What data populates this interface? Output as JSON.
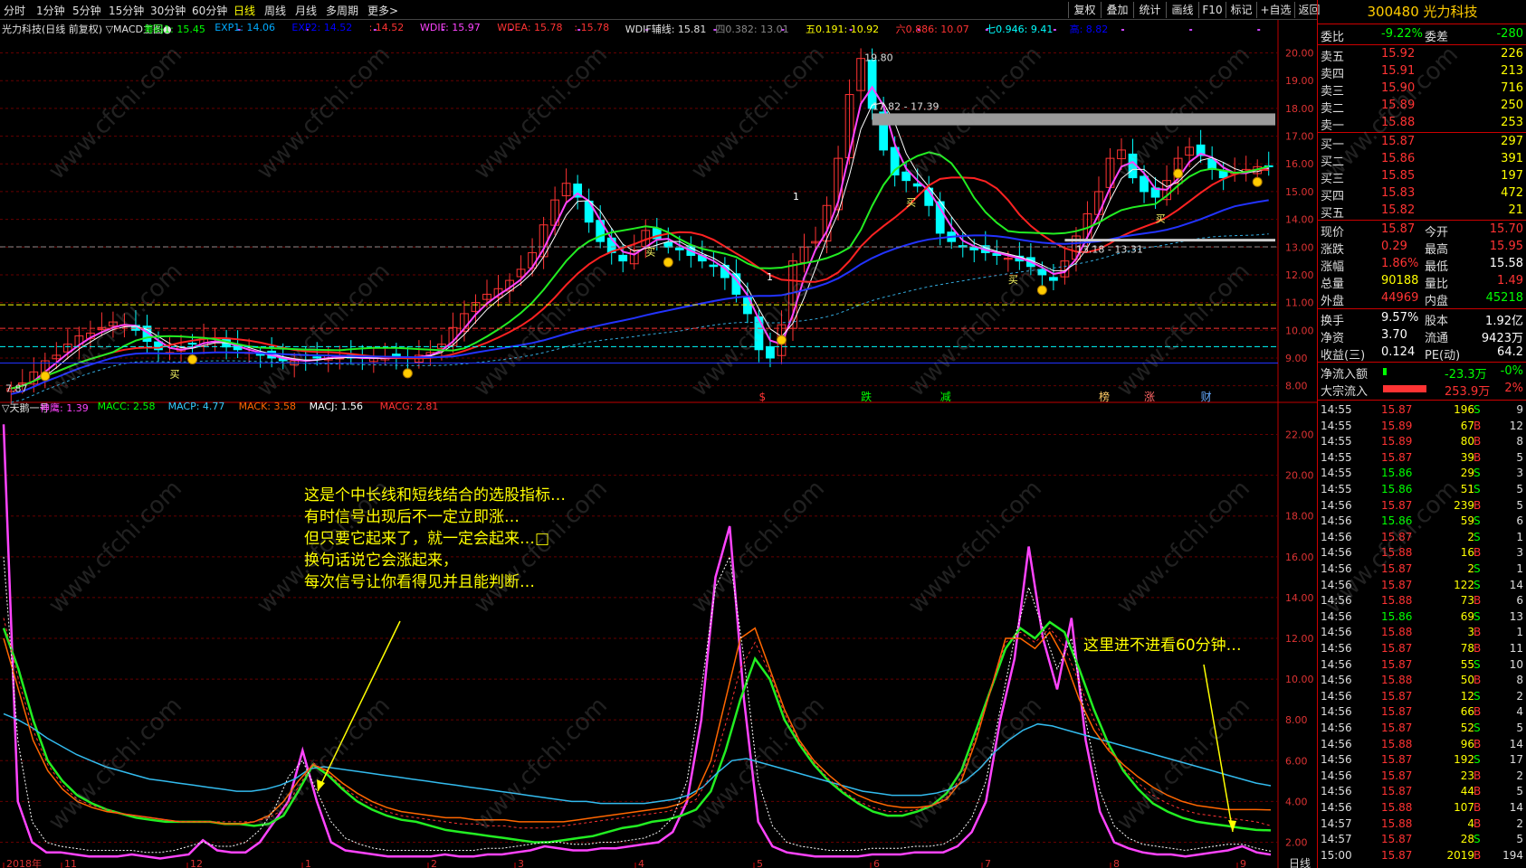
{
  "toolbar": {
    "periods": [
      "分时",
      "1分钟",
      "5分钟",
      "15分钟",
      "30分钟",
      "60分钟",
      "日线",
      "周线",
      "月线",
      "多周期",
      "更多>"
    ],
    "active": "日线",
    "right": [
      "复权",
      "叠加",
      "统计",
      "画线",
      "F10",
      "标记",
      "+自选",
      "返回"
    ]
  },
  "stock": {
    "code": "300480",
    "name": "光力科技"
  },
  "main_legend": [
    {
      "t": "光力科技(日线 前复权) ▽MACD主图●",
      "c": "#e0e0e0"
    },
    {
      "t": "筹码1: 15.45",
      "c": "#00ff00"
    },
    {
      "t": "EXP1: 14.06",
      "c": "#00aaff"
    },
    {
      "t": "EXP2: 14.52",
      "c": "#0000ff"
    },
    {
      "t": ": 14.52",
      "c": "#ff3333"
    },
    {
      "t": "WDIF: 15.97",
      "c": "#ff44ff"
    },
    {
      "t": "WDEA: 15.78",
      "c": "#ff3333"
    },
    {
      "t": ": 15.78",
      "c": "#ff3333"
    },
    {
      "t": "WDIF辅线: 15.81",
      "c": "#e0e0e0"
    },
    {
      "t": "四0.382: 13.01",
      "c": "#888888"
    },
    {
      "t": "五0.191: 10.92",
      "c": "#ffff00"
    },
    {
      "t": "六0.886: 10.07",
      "c": "#ff3333"
    },
    {
      "t": "七0.946: 9.41",
      "c": "#00ffff"
    },
    {
      "t": "高: 8.82",
      "c": "#0000ff"
    }
  ],
  "sub_legend": [
    {
      "t": "▽天鹅一号",
      "c": "#e0e0e0"
    },
    {
      "t": "神鹰: 1.39",
      "c": "#ff44ff"
    },
    {
      "t": "MACC: 2.58",
      "c": "#00ff00"
    },
    {
      "t": "MACP: 4.77",
      "c": "#33ccff"
    },
    {
      "t": "MACK: 3.58",
      "c": "#ff6600"
    },
    {
      "t": "MACJ: 1.56",
      "c": "#ffffff"
    },
    {
      "t": "MACG: 2.81",
      "c": "#ff3333"
    }
  ],
  "colors": {
    "up": "#ff3333",
    "down": "#00ffff",
    "bg": "#000000",
    "grid": "#c00000"
  },
  "chart_data": [
    {
      "type": "candlestick",
      "title": "光力科技(日线 前复权)",
      "ylim": [
        7.5,
        20.8
      ],
      "yticks": [
        8,
        9,
        10,
        11,
        12,
        13,
        14,
        15,
        16,
        17,
        18,
        19,
        20
      ],
      "ohlc_start": "2018-10",
      "close": [
        7.9,
        8.1,
        8.5,
        8.9,
        9.1,
        9.5,
        9.8,
        9.9,
        10.1,
        10.3,
        10.2,
        10.0,
        9.6,
        9.3,
        9.2,
        9.4,
        9.5,
        9.7,
        9.6,
        9.4,
        9.3,
        9.2,
        9.1,
        9.0,
        8.9,
        8.9,
        8.9,
        9.0,
        9.1,
        9.0,
        9.0,
        9.0,
        9.0,
        9.0,
        9.0,
        9.0,
        9.1,
        9.2,
        9.5,
        10.1,
        10.6,
        11.0,
        11.3,
        11.5,
        11.8,
        12.2,
        12.8,
        13.8,
        14.7,
        15.3,
        14.8,
        13.9,
        13.2,
        12.8,
        12.5,
        12.9,
        13.6,
        13.3,
        13.0,
        12.9,
        12.7,
        12.5,
        12.3,
        11.9,
        11.3,
        10.6,
        9.3,
        9.0,
        10.2,
        12.5,
        13.0,
        13.2,
        14.5,
        16.2,
        18.5,
        19.8,
        18.0,
        16.5,
        15.6,
        15.4,
        15.2,
        14.5,
        13.5,
        13.2,
        13.0,
        12.9,
        12.8,
        12.7,
        12.6,
        12.5,
        12.3,
        12.0,
        11.8,
        12.5,
        13.4,
        14.2,
        15.0,
        16.2,
        16.5,
        15.5,
        15.0,
        14.8,
        15.4,
        16.2,
        16.6,
        16.3,
        15.8,
        15.5,
        15.7,
        15.8,
        15.9,
        15.9
      ]
    },
    {
      "type": "line",
      "title": "天鹅一号",
      "ylim": [
        1.0,
        23.0
      ],
      "yticks": [
        2,
        4,
        6,
        8,
        10,
        12,
        14,
        16,
        18,
        20,
        22
      ],
      "xticks": [
        "2018年",
        "11",
        "12",
        "1",
        "2",
        "3",
        "4",
        "5",
        "6",
        "7",
        "8",
        "9"
      ],
      "series": [
        {
          "name": "神鹰",
          "values": [
            22.5,
            4.0,
            2.0,
            1.5,
            1.5,
            1.4,
            1.3,
            1.3,
            1.3,
            1.4,
            1.3,
            1.2,
            1.3,
            1.4,
            2.1,
            1.6,
            1.5,
            1.5,
            2.0,
            3.0,
            4.0,
            6.5,
            4.0,
            2.0,
            1.6,
            1.5,
            1.4,
            1.3,
            1.3,
            1.3,
            1.3,
            1.4,
            1.3,
            1.3,
            1.4,
            1.4,
            1.5,
            1.6,
            1.8,
            1.7,
            1.6,
            1.6,
            1.7,
            1.7,
            1.8,
            1.9,
            2.0,
            2.5,
            4.0,
            8.0,
            15.0,
            17.5,
            9.0,
            3.0,
            1.8,
            1.5,
            1.4,
            1.3,
            1.3,
            1.3,
            1.3,
            1.4,
            1.4,
            1.4,
            1.5,
            1.5,
            1.5,
            1.8,
            2.5,
            4.0,
            8.0,
            11.0,
            16.5,
            12.0,
            9.5,
            13.0,
            7.0,
            3.5,
            2.0,
            1.7,
            1.5,
            1.4,
            1.4,
            1.3,
            1.4,
            1.5,
            1.6,
            1.8,
            1.5,
            1.39
          ]
        },
        {
          "name": "MACC",
          "values": [
            12.5,
            10.5,
            8.0,
            6.0,
            5.0,
            4.3,
            3.9,
            3.6,
            3.4,
            3.2,
            3.1,
            3.0,
            3.0,
            3.0,
            3.0,
            2.9,
            2.9,
            2.8,
            2.9,
            3.3,
            4.5,
            5.8,
            5.3,
            4.6,
            4.0,
            3.6,
            3.3,
            3.1,
            3.0,
            2.8,
            2.6,
            2.5,
            2.4,
            2.3,
            2.2,
            2.1,
            2.0,
            2.0,
            2.1,
            2.2,
            2.3,
            2.5,
            2.7,
            2.8,
            3.0,
            3.1,
            3.3,
            3.6,
            4.5,
            6.5,
            9.0,
            11.0,
            10.0,
            8.0,
            6.8,
            5.8,
            5.0,
            4.4,
            3.9,
            3.5,
            3.3,
            3.3,
            3.5,
            3.8,
            4.4,
            5.5,
            7.5,
            9.5,
            11.5,
            12.5,
            12.0,
            12.8,
            12.3,
            10.5,
            8.5,
            6.8,
            5.5,
            4.6,
            3.9,
            3.5,
            3.2,
            3.0,
            2.9,
            2.8,
            2.7,
            2.6,
            2.58
          ]
        },
        {
          "name": "MACP",
          "values": [
            8.3,
            8.0,
            7.6,
            7.1,
            6.7,
            6.3,
            6.0,
            5.7,
            5.5,
            5.3,
            5.1,
            5.0,
            4.9,
            4.8,
            4.7,
            4.6,
            4.5,
            4.5,
            4.6,
            4.8,
            5.1,
            5.6,
            5.7,
            5.6,
            5.5,
            5.4,
            5.3,
            5.2,
            5.1,
            5.0,
            4.9,
            4.8,
            4.7,
            4.6,
            4.5,
            4.4,
            4.3,
            4.2,
            4.1,
            4.0,
            4.0,
            3.9,
            3.9,
            3.9,
            3.9,
            4.0,
            4.1,
            4.3,
            4.7,
            5.4,
            6.0,
            6.1,
            5.9,
            5.7,
            5.5,
            5.3,
            5.1,
            4.9,
            4.7,
            4.5,
            4.4,
            4.3,
            4.3,
            4.3,
            4.4,
            4.6,
            5.0,
            5.6,
            6.4,
            7.0,
            7.5,
            7.8,
            7.7,
            7.5,
            7.3,
            7.1,
            6.9,
            6.7,
            6.5,
            6.3,
            6.1,
            5.9,
            5.7,
            5.5,
            5.3,
            5.1,
            4.9,
            4.77
          ]
        },
        {
          "name": "MACK",
          "values": [
            12.0,
            9.5,
            7.0,
            5.5,
            4.6,
            4.0,
            3.7,
            3.5,
            3.4,
            3.3,
            3.2,
            3.1,
            3.0,
            3.0,
            3.0,
            2.9,
            2.9,
            3.0,
            3.3,
            4.0,
            5.0,
            5.8,
            5.5,
            4.9,
            4.4,
            4.0,
            3.7,
            3.5,
            3.4,
            3.3,
            3.2,
            3.2,
            3.1,
            3.1,
            3.1,
            3.0,
            3.0,
            3.0,
            3.0,
            3.1,
            3.2,
            3.3,
            3.4,
            3.5,
            3.6,
            3.7,
            3.9,
            4.4,
            6.0,
            9.0,
            12.0,
            12.5,
            10.5,
            8.5,
            7.0,
            6.0,
            5.3,
            4.7,
            4.3,
            4.0,
            3.8,
            3.7,
            3.7,
            3.8,
            4.1,
            5.0,
            7.0,
            9.5,
            12.0,
            12.0,
            11.5,
            12.3,
            11.0,
            9.0,
            7.5,
            6.5,
            5.8,
            5.2,
            4.7,
            4.3,
            4.0,
            3.8,
            3.7,
            3.6,
            3.6,
            3.6,
            3.58
          ]
        },
        {
          "name": "MACJ",
          "values": [
            16.0,
            7.0,
            3.0,
            2.0,
            1.8,
            1.7,
            1.6,
            1.6,
            1.6,
            1.6,
            1.5,
            1.5,
            1.6,
            1.8,
            2.0,
            1.8,
            1.8,
            2.0,
            2.6,
            3.6,
            5.2,
            6.0,
            4.5,
            3.0,
            2.2,
            1.9,
            1.7,
            1.6,
            1.6,
            1.6,
            1.6,
            1.6,
            1.6,
            1.6,
            1.7,
            1.7,
            1.8,
            1.9,
            2.0,
            2.0,
            1.9,
            1.9,
            2.0,
            2.0,
            2.1,
            2.2,
            2.5,
            3.2,
            5.0,
            9.5,
            14.5,
            16.0,
            11.0,
            5.0,
            2.8,
            2.0,
            1.8,
            1.7,
            1.6,
            1.6,
            1.6,
            1.7,
            1.7,
            1.7,
            1.8,
            1.8,
            1.9,
            2.3,
            3.2,
            5.0,
            8.5,
            12.0,
            14.5,
            12.5,
            10.5,
            12.0,
            8.0,
            4.5,
            2.8,
            2.2,
            1.9,
            1.8,
            1.7,
            1.6,
            1.7,
            1.8,
            1.9,
            1.9,
            1.7,
            1.56
          ]
        },
        {
          "name": "MACG",
          "values": [
            13.0,
            10.0,
            7.5,
            5.8,
            4.8,
            4.1,
            3.8,
            3.6,
            3.4,
            3.3,
            3.2,
            3.1,
            3.0,
            3.0,
            3.0,
            3.0,
            3.0,
            3.0,
            3.2,
            3.6,
            4.7,
            5.9,
            5.4,
            4.7,
            4.2,
            3.8,
            3.5,
            3.3,
            3.2,
            3.1,
            3.0,
            2.9,
            2.9,
            2.8,
            2.8,
            2.7,
            2.7,
            2.7,
            2.8,
            2.9,
            3.0,
            3.1,
            3.2,
            3.3,
            3.4,
            3.5,
            3.7,
            4.1,
            5.3,
            7.8,
            10.5,
            11.8,
            10.3,
            8.3,
            6.9,
            5.9,
            5.1,
            4.5,
            4.0,
            3.7,
            3.5,
            3.5,
            3.6,
            3.8,
            4.2,
            5.2,
            7.2,
            9.5,
            11.8,
            12.3,
            11.8,
            12.5,
            11.6,
            9.8,
            8.0,
            6.6,
            5.6,
            4.9,
            4.3,
            3.9,
            3.6,
            3.4,
            3.3,
            3.2,
            3.1,
            3.0,
            2.81
          ]
        }
      ]
    }
  ],
  "annotations": {
    "high": "19.80",
    "low": "7.87",
    "band1": "17.82 - 17.39",
    "band2": "13.18 - 13.31",
    "buy": "买",
    "ones": "1"
  },
  "event_marks": [
    {
      "t": "$",
      "c": "#ff3333"
    },
    {
      "t": "跌",
      "c": "#00ff00"
    },
    {
      "t": "减",
      "c": "#00ff00"
    },
    {
      "t": "榜",
      "c": "#ffcc66"
    },
    {
      "t": "涨",
      "c": "#ff6666"
    },
    {
      "t": "财",
      "c": "#66aaff"
    }
  ],
  "notes": {
    "text1": [
      "这是个中长线和短线结合的选股指标…",
      "有时信号出现后不一定立即涨…",
      "但只要它起来了，就一定会起来…□",
      "换句话说它会涨起来，",
      "每次信号让你看得见并且能判断…"
    ],
    "text2": "这里进不进看60分钟…"
  },
  "watermark": "www.cfchi.com",
  "quote": {
    "wb": {
      "l1": "委比",
      "v1": "-9.22%",
      "l2": "委差",
      "v2": "-280"
    },
    "sell": [
      {
        "l": "卖五",
        "p": "15.92",
        "v": "226"
      },
      {
        "l": "卖四",
        "p": "15.91",
        "v": "213"
      },
      {
        "l": "卖三",
        "p": "15.90",
        "v": "716"
      },
      {
        "l": "卖二",
        "p": "15.89",
        "v": "250"
      },
      {
        "l": "卖一",
        "p": "15.88",
        "v": "253"
      }
    ],
    "buy": [
      {
        "l": "买一",
        "p": "15.87",
        "v": "297"
      },
      {
        "l": "买二",
        "p": "15.86",
        "v": "391"
      },
      {
        "l": "买三",
        "p": "15.85",
        "v": "197"
      },
      {
        "l": "买四",
        "p": "15.83",
        "v": "472"
      },
      {
        "l": "买五",
        "p": "15.82",
        "v": "21"
      }
    ],
    "stats": [
      {
        "l1": "现价",
        "v1": "15.87",
        "c1": "#ff3333",
        "l2": "今开",
        "v2": "15.70",
        "c2": "#ff3333"
      },
      {
        "l1": "涨跌",
        "v1": "0.29",
        "c1": "#ff3333",
        "l2": "最高",
        "v2": "15.95",
        "c2": "#ff3333"
      },
      {
        "l1": "涨幅",
        "v1": "1.86%",
        "c1": "#ff3333",
        "l2": "最低",
        "v2": "15.58",
        "c2": "#ffffff"
      },
      {
        "l1": "总量",
        "v1": "90188",
        "c1": "#ffff00",
        "l2": "量比",
        "v2": "1.49",
        "c2": "#ff3333"
      },
      {
        "l1": "外盘",
        "v1": "44969",
        "c1": "#ff3333",
        "l2": "内盘",
        "v2": "45218",
        "c2": "#00ff00"
      },
      {
        "l1": "换手",
        "v1": "9.57%",
        "c1": "#ffffff",
        "l2": "股本",
        "v2": "1.92亿",
        "c2": "#ffffff"
      },
      {
        "l1": "净资",
        "v1": "3.70",
        "c1": "#ffffff",
        "l2": "流通",
        "v2": "9423万",
        "c2": "#ffffff"
      },
      {
        "l1": "收益(三)",
        "v1": "0.124",
        "c1": "#ffffff",
        "l2": "PE(动)",
        "v2": "64.2",
        "c2": "#ffffff"
      }
    ],
    "flow": [
      {
        "l": "净流入额",
        "v": "-23.3万",
        "p": "-0%",
        "c": "#00ff00"
      },
      {
        "l": "大宗流入",
        "v": "253.9万",
        "p": "2%",
        "c": "#ff3333"
      }
    ],
    "ticks": [
      [
        "14:55",
        "15.87",
        "196",
        "S",
        "9"
      ],
      [
        "14:55",
        "15.89",
        "67",
        "B",
        "12"
      ],
      [
        "14:55",
        "15.89",
        "80",
        "B",
        "8"
      ],
      [
        "14:55",
        "15.87",
        "39",
        "B",
        "5"
      ],
      [
        "14:55",
        "15.86",
        "29",
        "S",
        "3"
      ],
      [
        "14:55",
        "15.86",
        "51",
        "S",
        "5"
      ],
      [
        "14:56",
        "15.87",
        "239",
        "B",
        "5"
      ],
      [
        "14:56",
        "15.86",
        "59",
        "S",
        "6"
      ],
      [
        "14:56",
        "15.87",
        "2",
        "S",
        "1"
      ],
      [
        "14:56",
        "15.88",
        "16",
        "B",
        "3"
      ],
      [
        "14:56",
        "15.87",
        "2",
        "S",
        "1"
      ],
      [
        "14:56",
        "15.87",
        "122",
        "S",
        "14"
      ],
      [
        "14:56",
        "15.88",
        "73",
        "B",
        "6"
      ],
      [
        "14:56",
        "15.86",
        "69",
        "S",
        "13"
      ],
      [
        "14:56",
        "15.88",
        "3",
        "B",
        "1"
      ],
      [
        "14:56",
        "15.87",
        "78",
        "B",
        "11"
      ],
      [
        "14:56",
        "15.87",
        "55",
        "S",
        "10"
      ],
      [
        "14:56",
        "15.88",
        "50",
        "B",
        "8"
      ],
      [
        "14:56",
        "15.87",
        "12",
        "S",
        "2"
      ],
      [
        "14:56",
        "15.87",
        "66",
        "B",
        "4"
      ],
      [
        "14:56",
        "15.87",
        "52",
        "S",
        "5"
      ],
      [
        "14:56",
        "15.88",
        "96",
        "B",
        "14"
      ],
      [
        "14:56",
        "15.87",
        "192",
        "S",
        "17"
      ],
      [
        "14:56",
        "15.87",
        "23",
        "B",
        "2"
      ],
      [
        "14:56",
        "15.87",
        "44",
        "B",
        "5"
      ],
      [
        "14:56",
        "15.88",
        "107",
        "B",
        "14"
      ],
      [
        "14:57",
        "15.88",
        "4",
        "B",
        "2"
      ],
      [
        "14:57",
        "15.87",
        "28",
        "S",
        "5"
      ],
      [
        "15:00",
        "15.87",
        "2019",
        "B",
        "194"
      ]
    ],
    "period_label": "日线"
  }
}
